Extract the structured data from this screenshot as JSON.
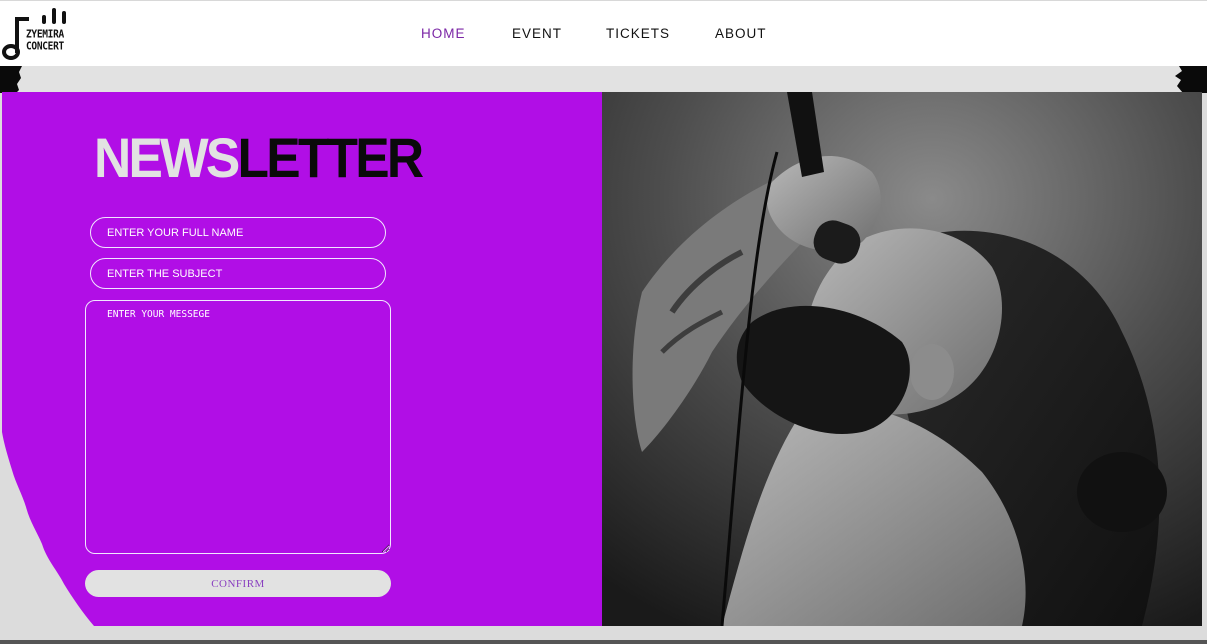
{
  "brand": {
    "line1": "ZYEMIRA",
    "line2": "CONCERT"
  },
  "nav": [
    {
      "label": "HOME",
      "active": true
    },
    {
      "label": "EVENT",
      "active": false
    },
    {
      "label": "TICKETS",
      "active": false
    },
    {
      "label": "ABOUT",
      "active": false
    }
  ],
  "newsletter": {
    "title_part1": "NEWS",
    "title_part2": "LETTER",
    "name_placeholder": "ENTER YOUR FULL NAME",
    "subject_placeholder": "ENTER THE SUBJECT",
    "message_placeholder": "ENTER YOUR MESSEGE",
    "confirm_label": "CONFIRM"
  },
  "colors": {
    "panel_purple": "#b10ee6",
    "nav_active": "#7b26a6",
    "page_gray": "#e2e2e2"
  }
}
